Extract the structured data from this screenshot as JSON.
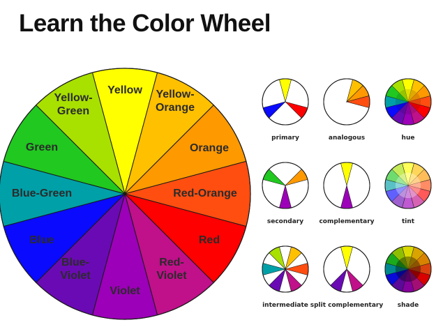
{
  "title": "Learn the Color Wheel",
  "wheel": {
    "segments": [
      {
        "name": "Yellow",
        "label_lines": [
          "Yellow"
        ],
        "color": "#ffff00",
        "text_color": "#2b2b2b"
      },
      {
        "name": "Yellow-Orange",
        "label_lines": [
          "Yellow-",
          "Orange"
        ],
        "color": "#ffc000",
        "text_color": "#2b2b2b"
      },
      {
        "name": "Orange",
        "label_lines": [
          "Orange"
        ],
        "color": "#ff9900",
        "text_color": "#2b2b2b"
      },
      {
        "name": "Red-Orange",
        "label_lines": [
          "Red-Orange"
        ],
        "color": "#ff4e10",
        "text_color": "#2b2b2b"
      },
      {
        "name": "Red",
        "label_lines": [
          "Red"
        ],
        "color": "#ff0000",
        "text_color": "#2b2b2b"
      },
      {
        "name": "Red-Violet",
        "label_lines": [
          "Red-",
          "Violet"
        ],
        "color": "#c0108a",
        "text_color": "#2b2b2b"
      },
      {
        "name": "Violet",
        "label_lines": [
          "Violet"
        ],
        "color": "#9c00b8",
        "text_color": "#2b2b2b"
      },
      {
        "name": "Blue-Violet",
        "label_lines": [
          "Blue-",
          "Violet"
        ],
        "color": "#6a0ab4",
        "text_color": "#2b2b2b"
      },
      {
        "name": "Blue",
        "label_lines": [
          "Blue"
        ],
        "color": "#0a0aff",
        "text_color": "#2b2b2b"
      },
      {
        "name": "Blue-Green",
        "label_lines": [
          "Blue-Green"
        ],
        "color": "#00a0a8",
        "text_color": "#2b2b2b"
      },
      {
        "name": "Green",
        "label_lines": [
          "Green"
        ],
        "color": "#20c820",
        "text_color": "#2b2b2b"
      },
      {
        "name": "Yellow-Green",
        "label_lines": [
          "Yellow-",
          "Green"
        ],
        "color": "#a8e000",
        "text_color": "#2b2b2b"
      }
    ]
  },
  "schemes": [
    {
      "name": "primary",
      "type": "slices",
      "slices": [
        0,
        4,
        8
      ]
    },
    {
      "name": "analogous",
      "type": "slices",
      "slices": [
        1,
        2,
        3
      ]
    },
    {
      "name": "hue",
      "type": "full",
      "tone": "hue"
    },
    {
      "name": "secondary",
      "type": "slices",
      "slices": [
        2,
        6,
        10
      ]
    },
    {
      "name": "complementary",
      "type": "slices",
      "slices": [
        0,
        6
      ]
    },
    {
      "name": "tint",
      "type": "full",
      "tone": "tint"
    },
    {
      "name": "intermediate",
      "type": "slices",
      "slices": [
        1,
        3,
        5,
        7,
        9,
        11
      ]
    },
    {
      "name": "split complementary",
      "type": "slices",
      "slices": [
        0,
        5,
        7
      ]
    },
    {
      "name": "shade",
      "type": "full",
      "tone": "shade"
    }
  ]
}
